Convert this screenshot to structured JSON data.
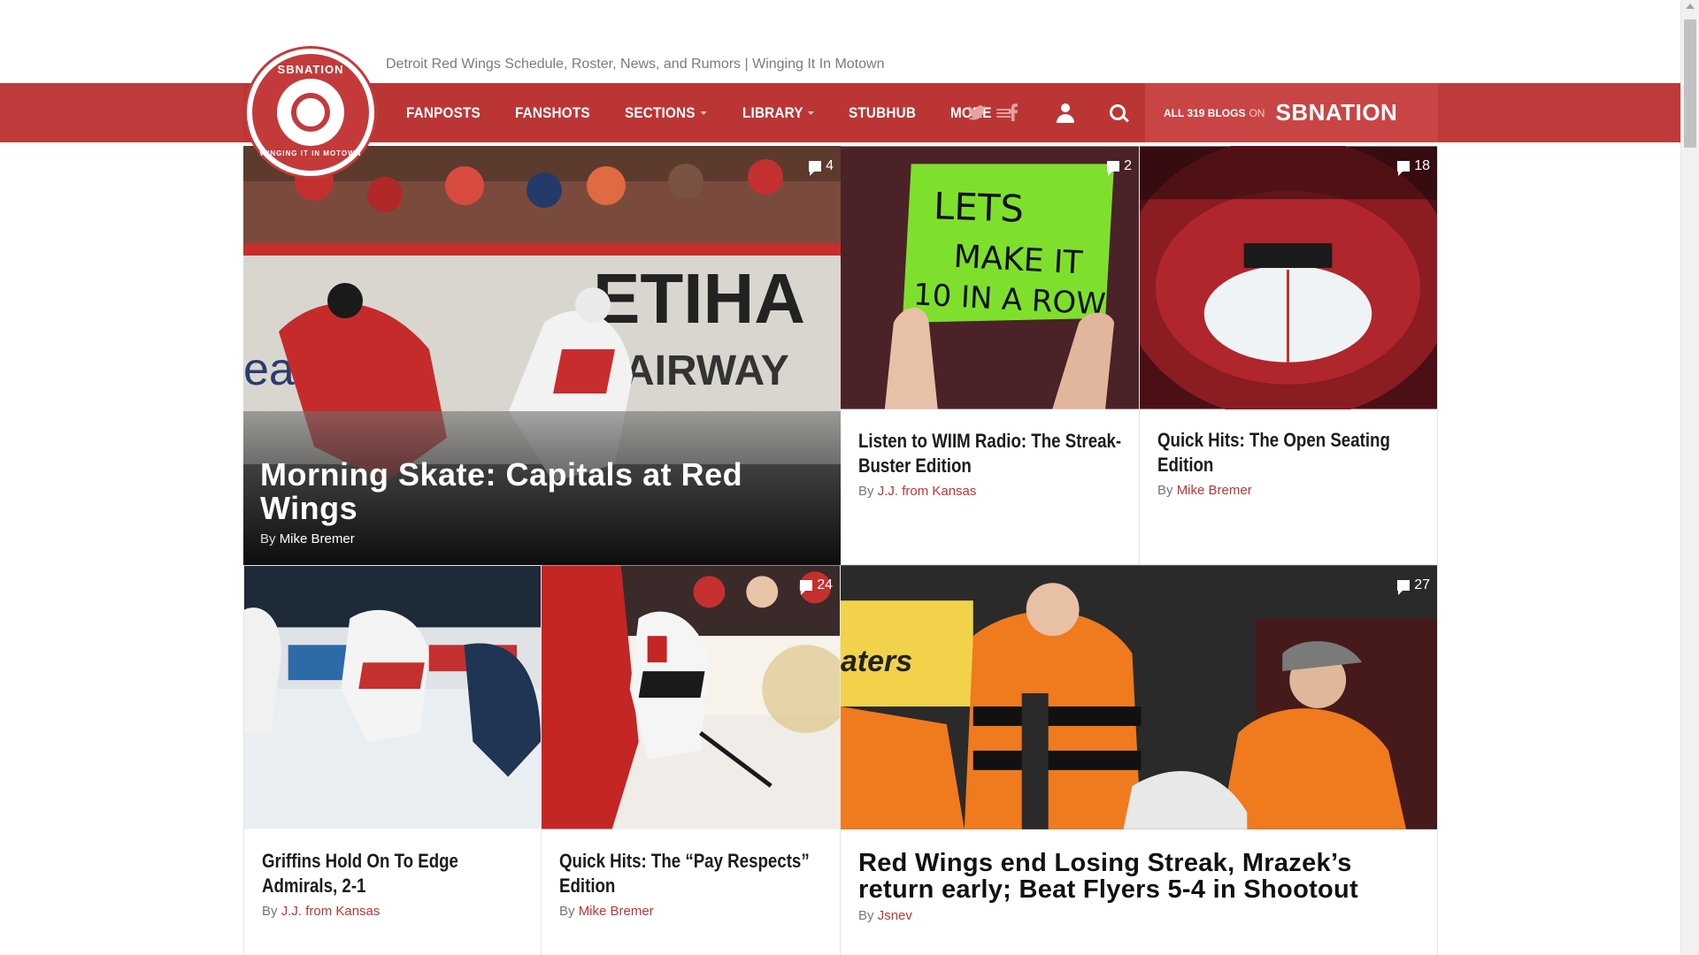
{
  "site": {
    "tagline": "Detroit Red Wings Schedule, Roster, News, and Rumors | Winging It In Motown",
    "logo_top_text": "SBNATION",
    "logo_bottom_text": "WINGING IT IN MOTOWN"
  },
  "nav": {
    "items": [
      {
        "label": "FANPOSTS",
        "caret": false
      },
      {
        "label": "FANSHOTS",
        "caret": false
      },
      {
        "label": "SECTIONS",
        "caret": true
      },
      {
        "label": "LIBRARY",
        "caret": true
      },
      {
        "label": "STUBHUB",
        "caret": false
      },
      {
        "label": "MORE",
        "caret": false
      }
    ],
    "twitter_icon": "twitter-icon",
    "facebook_icon": "facebook-icon",
    "blogs_prefix": "ALL 319 BLOGS",
    "blogs_on": "ON",
    "network": "SBNATION"
  },
  "cards": {
    "hero": {
      "title": "Morning Skate: Capitals at Red Wings",
      "by": "By",
      "author": "Mike Bremer",
      "comments": "4"
    },
    "c2": {
      "title": "Listen to WIIM Radio: The Streak-Buster Edition",
      "by": "By",
      "author": "J.J. from Kansas",
      "comments": "2",
      "sign_text": "LETS MAKE IT 10 IN A ROW"
    },
    "c3": {
      "title": "Quick Hits: The Open Seating Edition",
      "by": "By",
      "author": "Mike Bremer",
      "comments": "18"
    },
    "c4": {
      "title": "Griffins Hold On To Edge Admirals, 2-1",
      "by": "By",
      "author": "J.J. from Kansas"
    },
    "c5": {
      "title": "Quick Hits: The “Pay Respects” Edition",
      "by": "By",
      "author": "Mike Bremer",
      "comments": "24"
    },
    "c6": {
      "title": "Red Wings end Losing Streak, Mrazek’s return early; Beat Flyers 5-4 in Shootout",
      "by": "By",
      "author": "Jsnev",
      "comments": "27"
    }
  },
  "colors": {
    "brand": "#bc3535",
    "brand_light": "#c94545"
  }
}
